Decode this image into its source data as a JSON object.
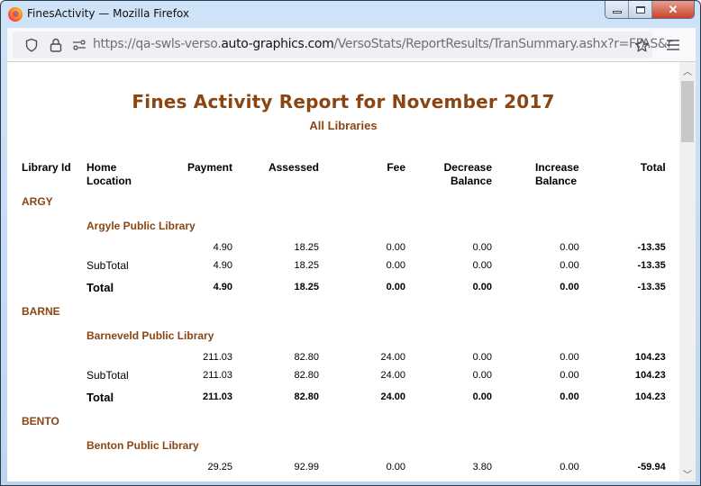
{
  "window": {
    "title": "FinesActivity — Mozilla Firefox",
    "controls": {
      "minimize": "minimize",
      "maximize": "maximize",
      "close": "✕"
    }
  },
  "navbar": {
    "url_prefix": "https://qa-swls-verso.",
    "url_host": "auto-graphics.com",
    "url_suffix": "/VersoStats/ReportResults/TranSummary.ashx?r=FFAS&r",
    "icons": [
      "shield-icon",
      "lock-icon",
      "permissions-icon",
      "bookmark-star-icon",
      "menu-icon"
    ]
  },
  "report": {
    "title": "Fines Activity Report for November 2017",
    "subtitle": "All Libraries",
    "columns": [
      "Library Id",
      "Home Location",
      "Payment",
      "Assessed",
      "Fee",
      "Decrease Balance",
      "Increase Balance",
      "Total"
    ],
    "column_lines": [
      [
        "Library Id"
      ],
      [
        "Home",
        "Location"
      ],
      [
        "Payment"
      ],
      [
        "Assessed"
      ],
      [
        "Fee"
      ],
      [
        "Decrease",
        "Balance"
      ],
      [
        "Increase",
        "Balance"
      ],
      [
        "Total"
      ]
    ],
    "subtotal_label": "SubTotal",
    "total_label": "Total",
    "libraries": [
      {
        "id": "ARGY",
        "name": "Argyle Public Library",
        "detail": [
          "4.90",
          "18.25",
          "0.00",
          "0.00",
          "0.00",
          "-13.35"
        ],
        "subtotal": [
          "4.90",
          "18.25",
          "0.00",
          "0.00",
          "0.00",
          "-13.35"
        ],
        "total": [
          "4.90",
          "18.25",
          "0.00",
          "0.00",
          "0.00",
          "-13.35"
        ]
      },
      {
        "id": "BARNE",
        "name": "Barneveld Public Library",
        "detail": [
          "211.03",
          "82.80",
          "24.00",
          "0.00",
          "0.00",
          "104.23"
        ],
        "subtotal": [
          "211.03",
          "82.80",
          "24.00",
          "0.00",
          "0.00",
          "104.23"
        ],
        "total": [
          "211.03",
          "82.80",
          "24.00",
          "0.00",
          "0.00",
          "104.23"
        ]
      },
      {
        "id": "BENTO",
        "name": "Benton Public Library",
        "detail": [
          "29.25",
          "92.99",
          "0.00",
          "3.80",
          "0.00",
          "-59.94"
        ]
      }
    ]
  },
  "colors": {
    "accent": "#8b4513"
  }
}
